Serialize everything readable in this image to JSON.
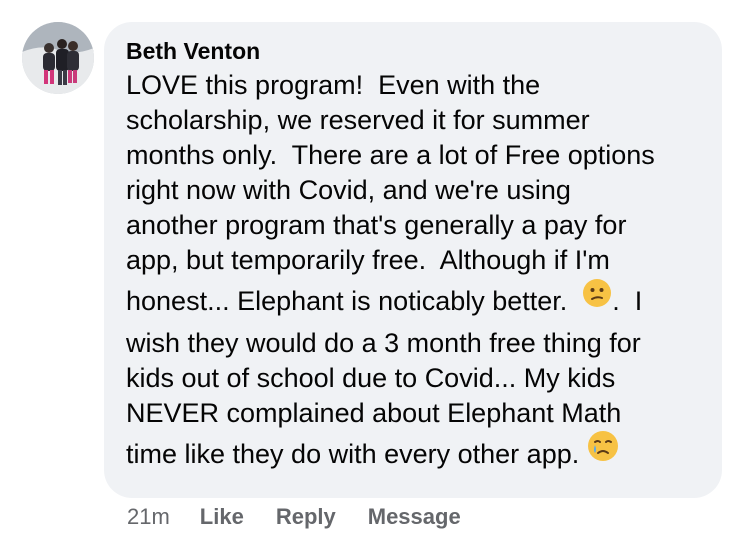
{
  "comment": {
    "author": "Beth Venton",
    "lines": [
      "LOVE this program!  Even with the",
      "scholarship, we reserved it for summer",
      "months only.  There are a lot of Free options",
      "right now with Covid, and we're using",
      "another program that's generally a pay for",
      "app, but temporarily free.  Although if I'm",
      "honest... Elephant is noticably better.  ",
      ".  I",
      "wish they would do a 3 month free thing for",
      "kids out of school due to Covid... My kids",
      "NEVER complained about Elephant Math",
      "time like they do with every other app. "
    ],
    "emojis": {
      "first": "confused-face-icon",
      "second": "crying-face-icon"
    }
  },
  "actions": {
    "time": "21m",
    "like": "Like",
    "reply": "Reply",
    "message": "Message"
  },
  "colors": {
    "bubble": "#f0f2f5",
    "text": "#050505",
    "meta": "#65676b",
    "emoji_yellow": "#f7c244",
    "emoji_tear": "#5aa8e8"
  }
}
